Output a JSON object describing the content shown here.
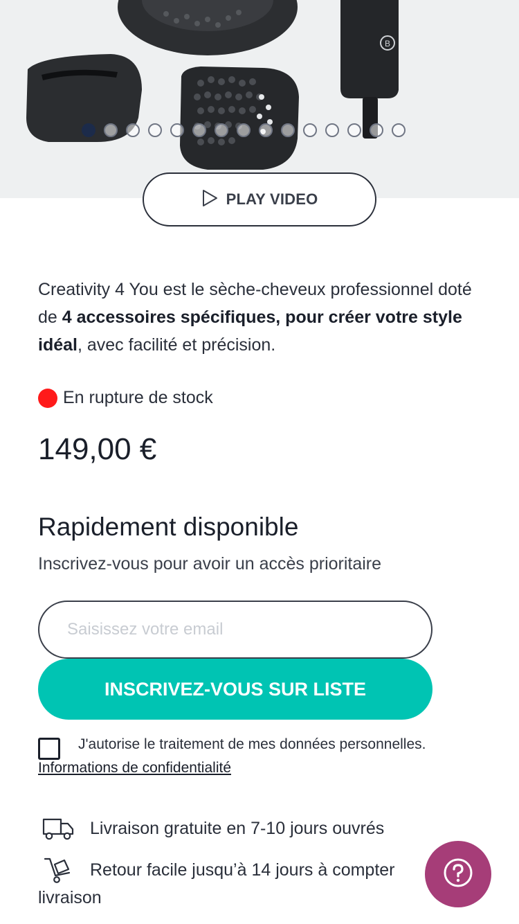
{
  "hero": {
    "carousel_dot_count": 15,
    "active_dot": 0,
    "play_label": "PLAY VIDEO",
    "play_icon": "play-icon"
  },
  "product": {
    "desc_start": "Creativity 4 You est le sèche-cheveux professionnel doté de ",
    "desc_bold": "4 accessoires spécifiques, pour créer votre style idéal",
    "desc_end": ", avec facilité et précision.",
    "stock_status": "En rupture de stock",
    "stock_color": "#ff1a1a",
    "price": "149,00 €"
  },
  "notify": {
    "title": "Rapidement disponible",
    "subtitle": "Inscrivez-vous pour avoir un accès prioritaire",
    "email_placeholder": "Saisissez votre email",
    "subscribe_label": "INSCRIVEZ-VOUS SUR LISTE",
    "consent_label": "J'autorise le traitement de mes données personnelles.",
    "privacy_link": "Informations de confidentialité"
  },
  "features": [
    {
      "icon": "delivery-truck-icon",
      "text": "Livraison gratuite en 7-10 jours ouvrés"
    },
    {
      "icon": "return-cart-icon",
      "text_line1": "Retour facile jusqu’à 14 jours à compter",
      "text_line2": "livraison"
    }
  ],
  "help": {
    "icon": "help-question-icon"
  },
  "colors": {
    "accent": "#00c4b3",
    "help_button": "#a63d78",
    "active_dot": "#1c2b4a",
    "hero_bg": "#eef0f1"
  }
}
